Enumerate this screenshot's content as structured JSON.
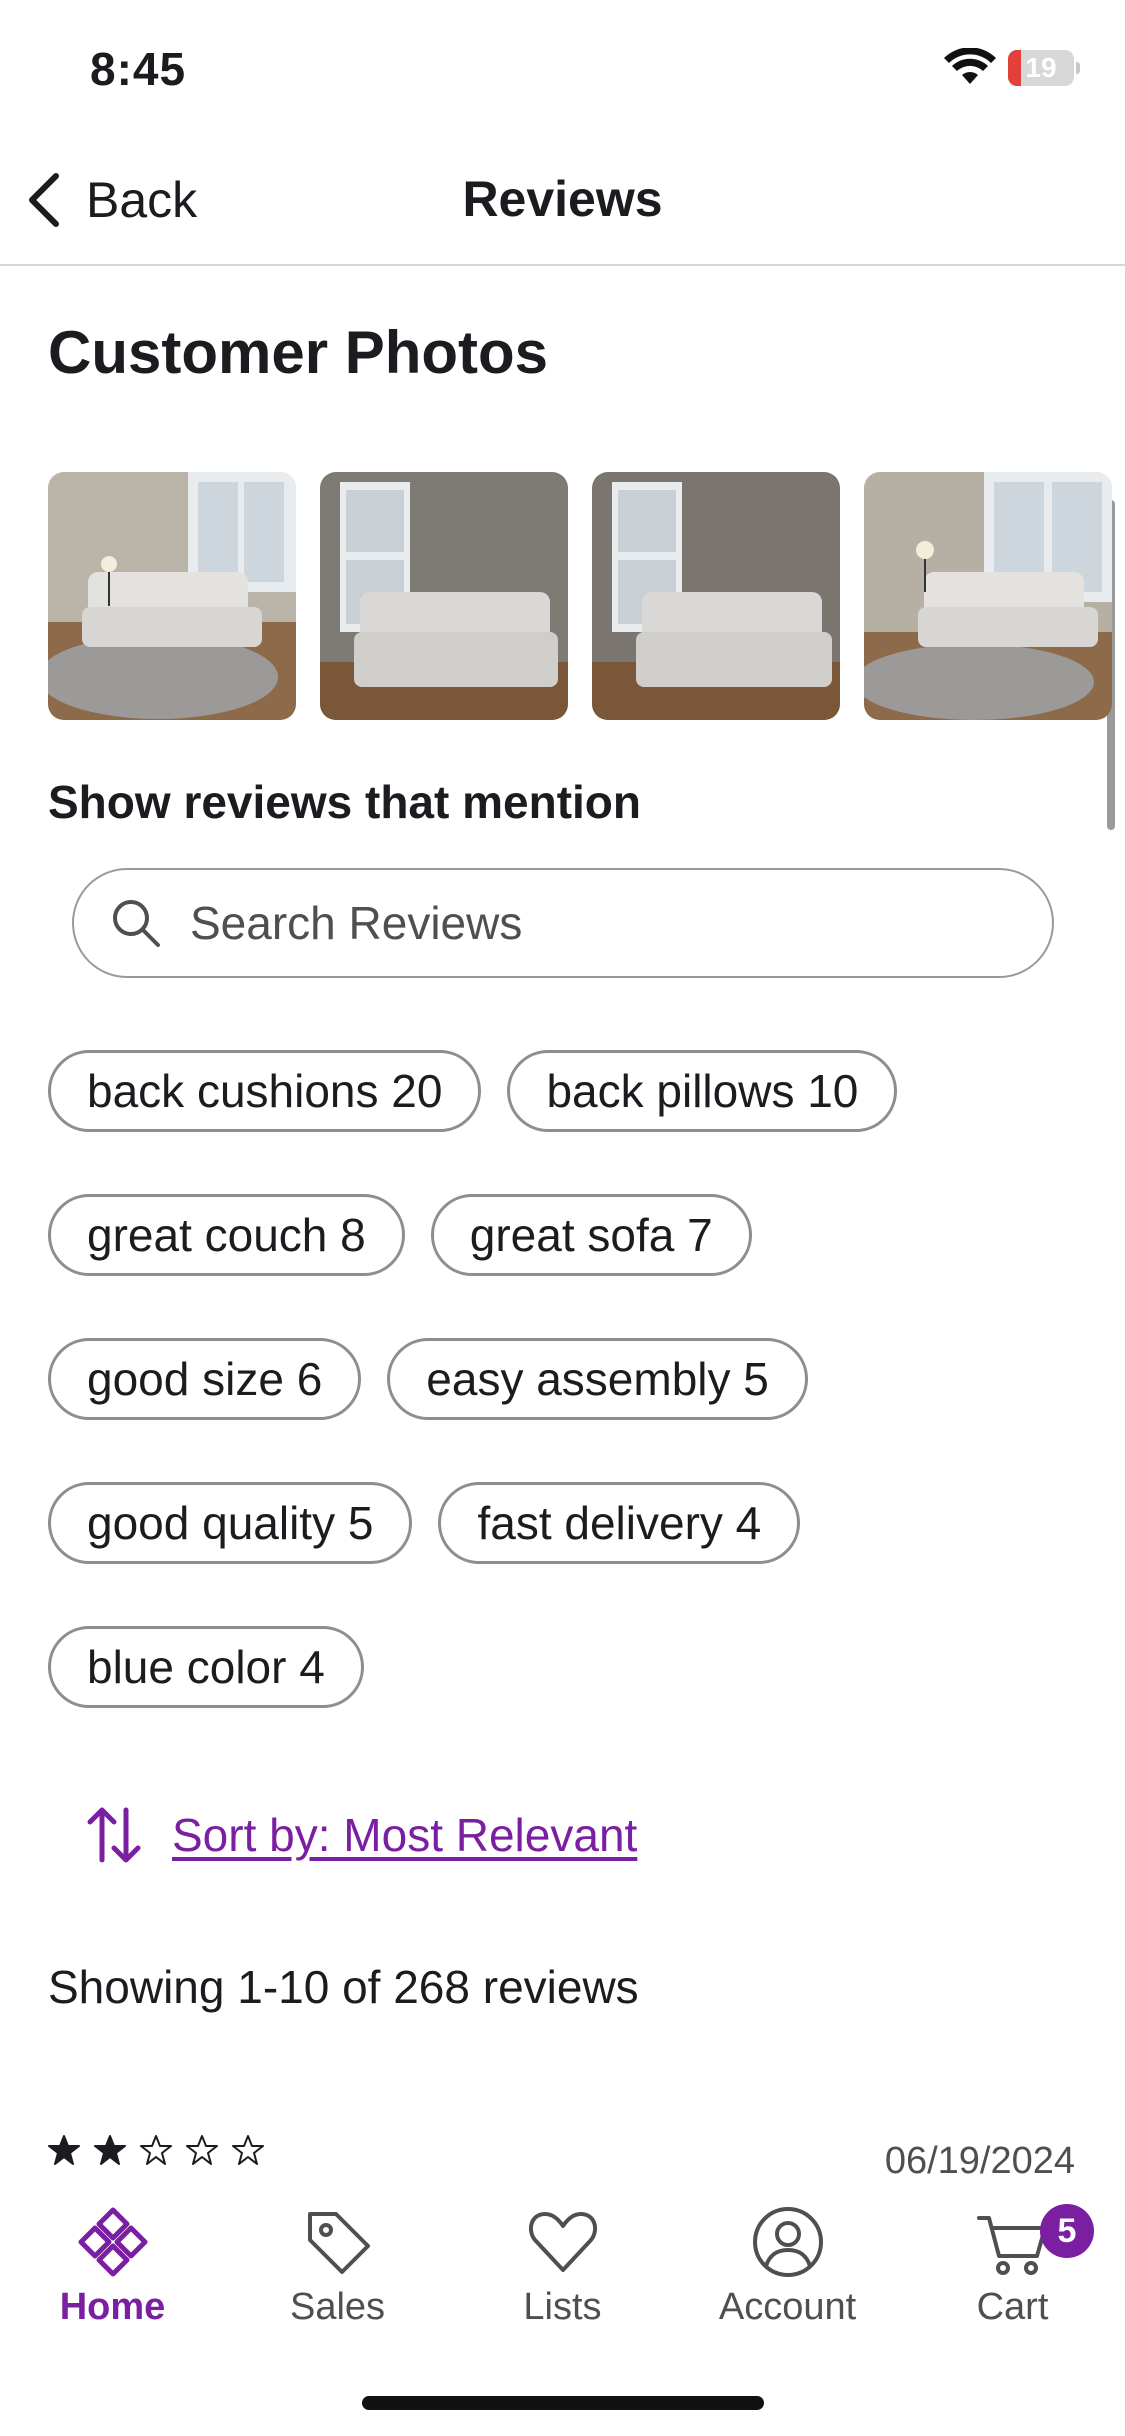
{
  "status_bar": {
    "time": "8:45",
    "battery": "19",
    "battery_level": 0.19
  },
  "header": {
    "back_label": "Back",
    "title": "Reviews"
  },
  "customer_photos": {
    "title": "Customer Photos",
    "photos": [
      {
        "name": "sofa-photo-1"
      },
      {
        "name": "sofa-photo-2"
      },
      {
        "name": "sofa-photo-3"
      },
      {
        "name": "sofa-photo-4"
      }
    ]
  },
  "mentions": {
    "title": "Show reviews that mention",
    "search_placeholder": "Search Reviews",
    "search_value": "",
    "chips": [
      "back cushions 20",
      "back pillows 10",
      "great couch 8",
      "great sofa 7",
      "good size 6",
      "easy assembly 5",
      "good quality 5",
      "fast delivery 4",
      "blue color 4"
    ]
  },
  "sort": {
    "label": "Sort by: Most Relevant"
  },
  "results": {
    "showing": "Showing 1-10 of 268 reviews"
  },
  "review": {
    "rating": 2,
    "max_rating": 5,
    "date": "06/19/2024"
  },
  "tab_bar": {
    "tabs": [
      {
        "label": "Home",
        "icon": "home-diamond-icon",
        "active": true
      },
      {
        "label": "Sales",
        "icon": "tag-icon",
        "active": false
      },
      {
        "label": "Lists",
        "icon": "heart-icon",
        "active": false
      },
      {
        "label": "Account",
        "icon": "account-icon",
        "active": false
      },
      {
        "label": "Cart",
        "icon": "cart-icon",
        "active": false
      }
    ],
    "cart_count": "5"
  },
  "colors": {
    "accent": "#7b1fa2",
    "text": "#1c1b1f",
    "chip_border": "#8e8e8e",
    "battery_low": "#e1403b"
  }
}
